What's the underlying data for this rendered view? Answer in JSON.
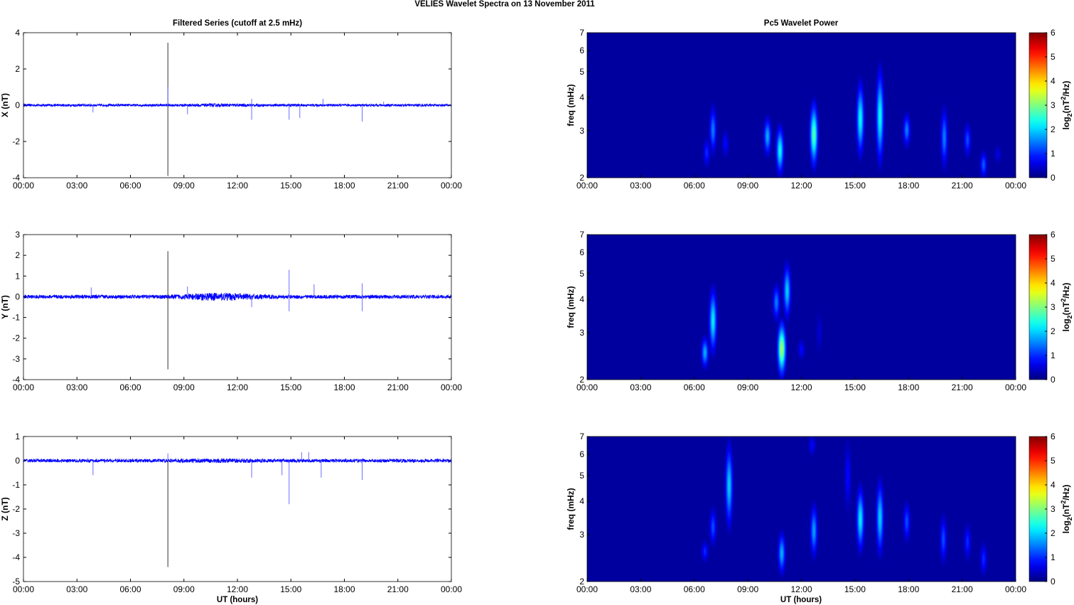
{
  "chart_data": {
    "type": "line+heatmap",
    "title": "VELIES Wavelet Spectra on 13 November  2011",
    "left_title": "Filtered Series (cutoff at 2.5 mHz)",
    "right_title": "Pc5 Wavelet Power",
    "xlabel": "UT (hours)",
    "x_ticks": [
      "00:00",
      "03:00",
      "06:00",
      "09:00",
      "12:00",
      "15:00",
      "18:00",
      "21:00",
      "00:00"
    ],
    "xlim_hours": [
      0,
      24
    ],
    "freq_label": "freq (mHz)",
    "freq_ticks": [
      2,
      3,
      4,
      5,
      6,
      7
    ],
    "freq_lim": [
      2,
      7
    ],
    "colorbar_label": "log2(nT^2/Hz)",
    "colorbar_ticks": [
      0,
      1,
      2,
      3,
      4,
      5,
      6
    ],
    "colorbar_lim": [
      0,
      6
    ],
    "series_color": "#0000ff",
    "panels": [
      {
        "component": "X",
        "ylabel": "X (nT)",
        "ylim": [
          -4,
          4
        ],
        "y_ticks": [
          -4,
          -2,
          0,
          2,
          4
        ],
        "noise_amplitude": 0.07,
        "spikes": [
          [
            8.1,
            3.45
          ],
          [
            8.1,
            -3.9
          ],
          [
            8.1,
            1.0
          ],
          [
            3.9,
            -0.4
          ],
          [
            9.2,
            -0.5
          ],
          [
            12.8,
            -0.8
          ],
          [
            12.8,
            0.35
          ],
          [
            14.9,
            -0.8
          ],
          [
            15.5,
            -0.7
          ],
          [
            16.8,
            0.35
          ],
          [
            19.0,
            -0.9
          ],
          [
            20.2,
            0.2
          ]
        ],
        "blobs": [
          {
            "t": 7.05,
            "f": [
              2.4,
              3.8
            ],
            "p": 1.5
          },
          {
            "t": 6.7,
            "f": [
              2.2,
              2.8
            ],
            "p": 1.0
          },
          {
            "t": 7.75,
            "f": [
              2.4,
              3.0
            ],
            "p": 0.8
          },
          {
            "t": 10.1,
            "f": [
              2.4,
              3.4
            ],
            "p": 1.8
          },
          {
            "t": 10.8,
            "f": [
              2.0,
              3.2
            ],
            "p": 2.3
          },
          {
            "t": 12.7,
            "f": [
              2.1,
              4.0
            ],
            "p": 2.8
          },
          {
            "t": 15.3,
            "f": [
              2.3,
              4.8
            ],
            "p": 2.3
          },
          {
            "t": 16.4,
            "f": [
              2.1,
              5.5
            ],
            "p": 2.3
          },
          {
            "t": 17.9,
            "f": [
              2.6,
              3.5
            ],
            "p": 1.5
          },
          {
            "t": 20.0,
            "f": [
              2.1,
              3.8
            ],
            "p": 1.5
          },
          {
            "t": 21.3,
            "f": [
              2.4,
              3.2
            ],
            "p": 1.2
          },
          {
            "t": 22.2,
            "f": [
              2.0,
              2.5
            ],
            "p": 1.3
          },
          {
            "t": 23.0,
            "f": [
              2.3,
              2.6
            ],
            "p": 0.6
          }
        ]
      },
      {
        "component": "Y",
        "ylabel": "Y (nT)",
        "ylim": [
          -4,
          3
        ],
        "y_ticks": [
          -4,
          -3,
          -2,
          -1,
          0,
          1,
          2,
          3
        ],
        "noise_amplitude": 0.09,
        "spikes": [
          [
            8.1,
            2.2
          ],
          [
            8.1,
            -3.5
          ],
          [
            14.9,
            1.3
          ],
          [
            14.9,
            -0.7
          ],
          [
            16.3,
            0.6
          ],
          [
            19.0,
            0.65
          ],
          [
            19.0,
            -0.7
          ],
          [
            3.8,
            0.45
          ],
          [
            9.2,
            0.5
          ],
          [
            12.8,
            -0.5
          ]
        ],
        "blobs": [
          {
            "t": 7.05,
            "f": [
              2.4,
              4.6
            ],
            "p": 2.2
          },
          {
            "t": 6.6,
            "f": [
              2.2,
              2.9
            ],
            "p": 1.8
          },
          {
            "t": 10.6,
            "f": [
              3.3,
              4.6
            ],
            "p": 1.5
          },
          {
            "t": 10.9,
            "f": [
              2.0,
              3.4
            ],
            "p": 3.3
          },
          {
            "t": 11.2,
            "f": [
              3.3,
              5.6
            ],
            "p": 2.0
          },
          {
            "t": 12.0,
            "f": [
              2.4,
              2.8
            ],
            "p": 0.8
          },
          {
            "t": 13.0,
            "f": [
              2.5,
              3.6
            ],
            "p": 0.5
          }
        ]
      },
      {
        "component": "Z",
        "ylabel": "Z (nT)",
        "ylim": [
          -5,
          1
        ],
        "y_ticks": [
          -5,
          -4,
          -3,
          -2,
          -1,
          0,
          1
        ],
        "noise_amplitude": 0.07,
        "spikes": [
          [
            8.1,
            -4.4
          ],
          [
            8.1,
            0.3
          ],
          [
            14.9,
            -1.8
          ],
          [
            3.9,
            -0.6
          ],
          [
            12.8,
            -0.7
          ],
          [
            14.5,
            -0.6
          ],
          [
            16.7,
            -0.7
          ],
          [
            19.0,
            -0.8
          ],
          [
            15.6,
            0.35
          ],
          [
            16.0,
            0.35
          ]
        ],
        "blobs": [
          {
            "t": 7.95,
            "f": [
              3.0,
              7.0
            ],
            "p": 2.0
          },
          {
            "t": 7.05,
            "f": [
              2.7,
              3.8
            ],
            "p": 1.2
          },
          {
            "t": 6.6,
            "f": [
              2.4,
              2.8
            ],
            "p": 1.0
          },
          {
            "t": 10.9,
            "f": [
              2.1,
              3.1
            ],
            "p": 1.8
          },
          {
            "t": 12.7,
            "f": [
              2.4,
              4.0
            ],
            "p": 1.7
          },
          {
            "t": 12.6,
            "f": [
              6.0,
              7.0
            ],
            "p": 0.8
          },
          {
            "t": 14.6,
            "f": [
              3.5,
              7.0
            ],
            "p": 0.8
          },
          {
            "t": 15.3,
            "f": [
              2.5,
              4.7
            ],
            "p": 2.2
          },
          {
            "t": 16.4,
            "f": [
              2.4,
              5.0
            ],
            "p": 2.0
          },
          {
            "t": 17.9,
            "f": [
              2.8,
              4.0
            ],
            "p": 1.2
          },
          {
            "t": 19.95,
            "f": [
              2.3,
              3.6
            ],
            "p": 1.2
          },
          {
            "t": 21.3,
            "f": [
              2.4,
              3.3
            ],
            "p": 1.0
          },
          {
            "t": 22.2,
            "f": [
              2.1,
              2.8
            ],
            "p": 1.0
          }
        ]
      }
    ]
  }
}
